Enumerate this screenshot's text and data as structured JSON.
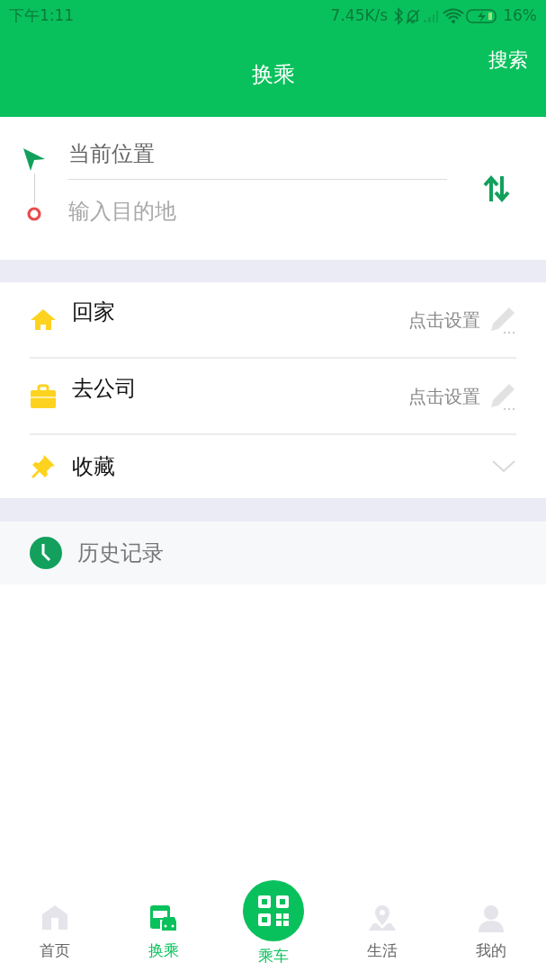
{
  "status_bar": {
    "time": "下午1:11",
    "speed": "7.45K/s",
    "battery": "16%"
  },
  "header": {
    "title": "换乘",
    "action": "搜索"
  },
  "route": {
    "origin": "当前位置",
    "destination_placeholder": "输入目的地"
  },
  "quick_items": [
    {
      "kind": "home",
      "label": "回家",
      "hint": "点击设置"
    },
    {
      "kind": "work",
      "label": "去公司",
      "hint": "点击设置"
    },
    {
      "kind": "favorites",
      "label": "收藏",
      "expanded": false
    }
  ],
  "history": {
    "label": "历史记录"
  },
  "tabs": [
    {
      "kind": "home",
      "label": "首页",
      "selected": false
    },
    {
      "kind": "transfer",
      "label": "换乘",
      "selected": true
    },
    {
      "kind": "ride",
      "label": "乘车",
      "selected": false
    },
    {
      "kind": "life",
      "label": "生活",
      "selected": false
    },
    {
      "kind": "me",
      "label": "我的",
      "selected": false
    }
  ]
}
